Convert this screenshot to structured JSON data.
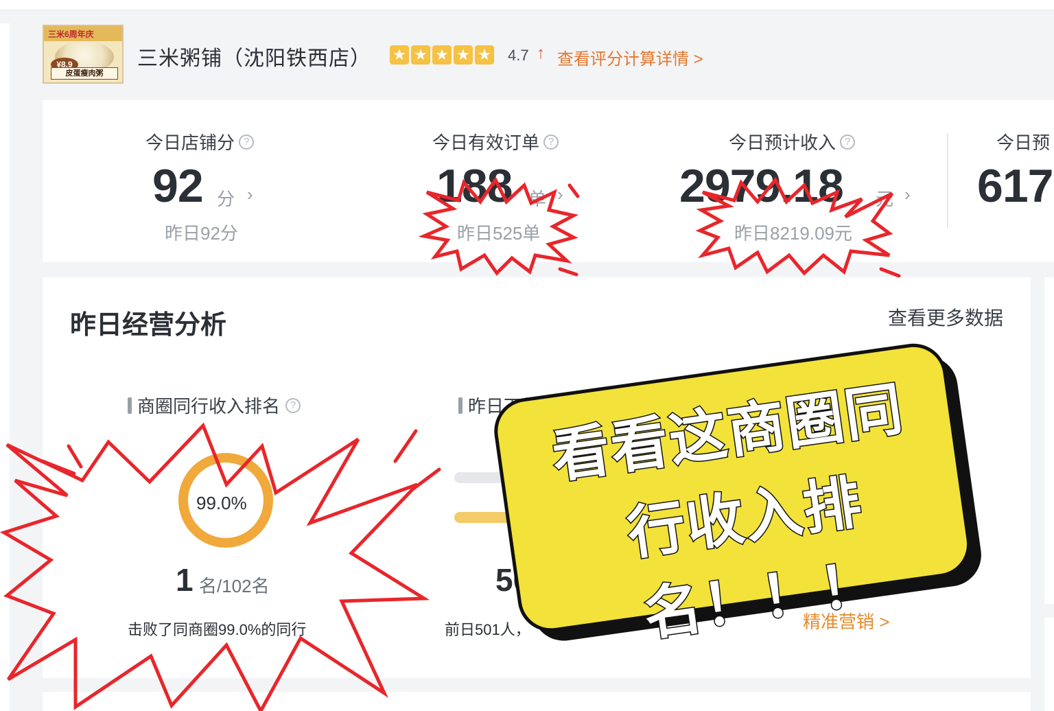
{
  "store": {
    "name": "三米粥铺（沈阳铁西店）",
    "logo_text_top": "三米6周年庆",
    "logo_price": "¥8.9",
    "logo_text_bottom": "皮蛋瘦肉粥",
    "rating_stars": 5,
    "rating": "4.7",
    "rating_trend_icon": "arrow-up-icon",
    "rating_link": "查看评分计算详情 >"
  },
  "stats": {
    "shop_score": {
      "label": "今日店铺分",
      "value": "92",
      "unit": "分",
      "prev": "昨日92分"
    },
    "orders": {
      "label": "今日有效订单",
      "value": "188",
      "unit": "单",
      "prev": "昨日525单"
    },
    "income": {
      "label": "今日预计收入",
      "value": "2979.18",
      "unit": "元",
      "prev": "昨日8219.09元"
    },
    "fourth": {
      "label": "今日预",
      "value": "617"
    }
  },
  "analysis": {
    "title": "昨日经营分析",
    "more_link": "查看更多数据",
    "revenue_rank": {
      "title": "商圈同行收入排名",
      "ring_percent_text": "99.0%",
      "ring_fraction": 0.99,
      "rank": "1",
      "rank_unit": "名/102名",
      "description": "击败了同商圈99.0%的同行"
    },
    "customers": {
      "title": "昨日下单顾客",
      "value": "50",
      "description": "前日501人，",
      "marketing_link": "精准营销 >"
    }
  },
  "sticker": {
    "line1": "看看这商圈同",
    "line2": "行收入排",
    "line3": "名！！！",
    "bg_color": "#f2e23a"
  },
  "colors": {
    "accent_orange": "#e5772d",
    "burst_red": "#e8262b",
    "ring_gold": "#f0a93a"
  }
}
